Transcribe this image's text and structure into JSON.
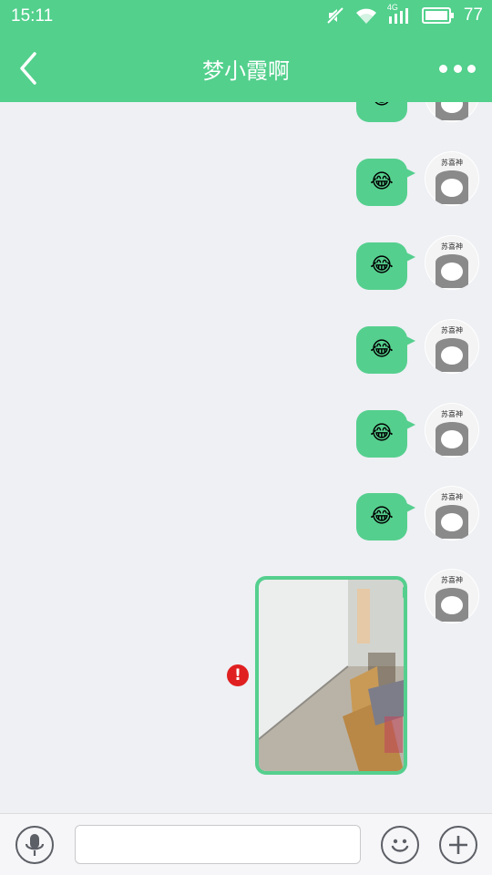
{
  "status_bar": {
    "time": "15:11",
    "battery_level": "77",
    "network_label": "4G"
  },
  "header": {
    "title": "梦小霞啊",
    "back_icon": "chevron-left-icon",
    "more_icon": "more-dots-icon"
  },
  "messages": [
    {
      "type": "emoji",
      "content": "😂",
      "sender": "self"
    },
    {
      "type": "emoji",
      "content": "😂",
      "sender": "self"
    },
    {
      "type": "emoji",
      "content": "😂",
      "sender": "self"
    },
    {
      "type": "emoji",
      "content": "😂",
      "sender": "self"
    },
    {
      "type": "emoji",
      "content": "😂",
      "sender": "self"
    },
    {
      "type": "emoji",
      "content": "😂",
      "sender": "self"
    },
    {
      "type": "image",
      "sender": "self",
      "status": "failed"
    }
  ],
  "avatar_text": "苏喜神",
  "error_mark": "!",
  "input_bar": {
    "voice_icon": "microphone-icon",
    "emoji_icon": "smiley-icon",
    "add_icon": "plus-icon",
    "text_value": "",
    "placeholder": ""
  },
  "colors": {
    "accent": "#52d08c",
    "bubble": "#55cf8e",
    "background": "#eef0f4",
    "error": "#e02020"
  }
}
